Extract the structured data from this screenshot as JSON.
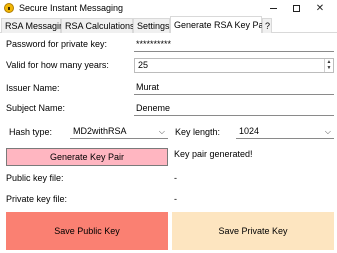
{
  "window": {
    "title": "Secure Instant Messaging",
    "minimize_glyph": "—",
    "maximize_glyph": "□",
    "close_glyph": "✕"
  },
  "tabs": [
    {
      "label": "RSA Messaging",
      "active": false
    },
    {
      "label": "RSA Calculations",
      "active": false
    },
    {
      "label": "Settings",
      "active": false
    },
    {
      "label": "Generate RSA Key Pair",
      "active": true
    },
    {
      "label": "?",
      "active": false
    }
  ],
  "form": {
    "password_label": "Password for private key:",
    "password_value": "**********",
    "years_label": "Valid for how many years:",
    "years_value": "25",
    "issuer_label": "Issuer Name:",
    "issuer_value": "Murat",
    "subject_label": "Subject Name:",
    "subject_value": "Deneme",
    "hash_label": "Hash type:",
    "hash_value": "MD2withRSA",
    "keylen_label": "Key length:",
    "keylen_value": "1024"
  },
  "actions": {
    "generate_label": "Generate Key Pair",
    "status_text": "Key pair generated!",
    "public_key_label": "Public key file:",
    "public_key_value": "-",
    "private_key_label": "Private key file:",
    "private_key_value": "-",
    "save_public_label": "Save Public Key",
    "save_private_label": "Save Private Key"
  },
  "colors": {
    "generate_button": "#ffb6c1",
    "save_public_button": "#fa8072",
    "save_private_button": "#fde5c0",
    "app_icon": "#f2b705"
  },
  "icons": {
    "app": "lock-icon",
    "spin_up": "triangle-up-icon",
    "spin_down": "triangle-down-icon",
    "combo": "chevron-down-icon"
  }
}
